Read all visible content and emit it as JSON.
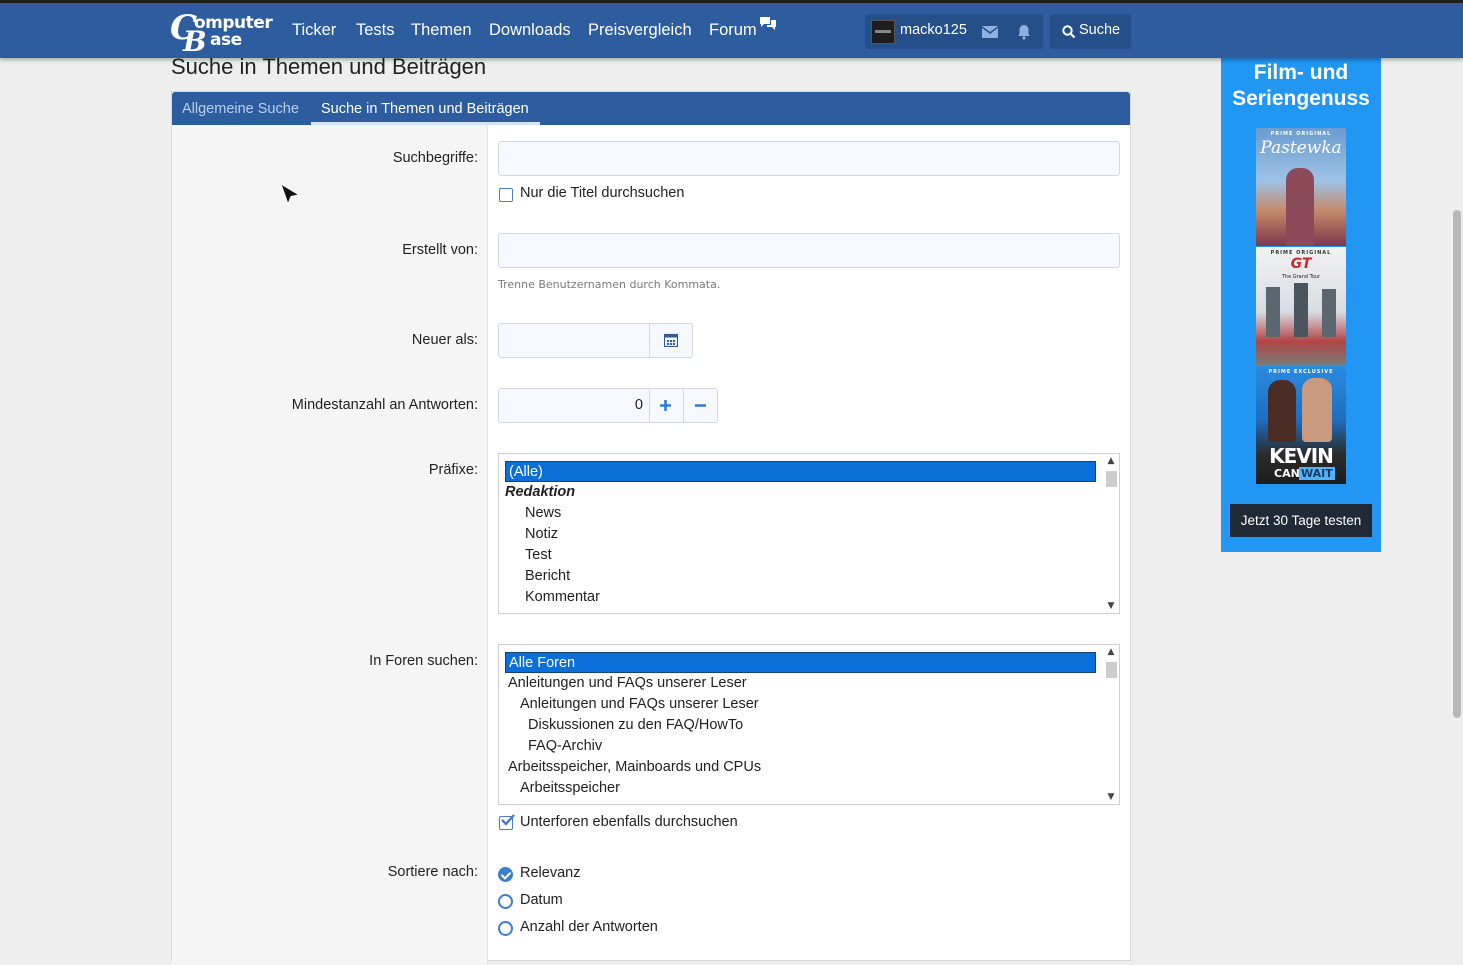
{
  "header": {
    "logo_top": "omputer",
    "logo_bottom": "ase",
    "logo_c": "C",
    "logo_b": "B",
    "nav": [
      "Ticker",
      "Tests",
      "Themen",
      "Downloads",
      "Preisvergleich",
      "Forum"
    ],
    "username": "macko125",
    "search_label": "Suche"
  },
  "page": {
    "title": "Suche in Themen und Beiträgen",
    "tabs": [
      "Allgemeine Suche",
      "Suche in Themen und Beiträgen"
    ]
  },
  "form": {
    "keywords_label": "Suchbegriffe:",
    "keywords_value": "",
    "titles_only_label": "Nur die Titel durchsuchen",
    "created_by_label": "Erstellt von:",
    "created_by_value": "",
    "created_by_hint": "Trenne Benutzernamen durch Kommata.",
    "newer_than_label": "Neuer als:",
    "min_replies_label": "Mindestanzahl an Antworten:",
    "min_replies_value": "0",
    "prefixes_label": "Präfixe:",
    "prefixes": [
      {
        "label": "(Alle)",
        "selected": true
      },
      {
        "label": "Redaktion",
        "group": true
      },
      {
        "label": "News"
      },
      {
        "label": "Notiz"
      },
      {
        "label": "Test"
      },
      {
        "label": "Bericht"
      },
      {
        "label": "Kommentar"
      }
    ],
    "forums_label": "In Foren suchen:",
    "forums": [
      {
        "label": "Alle Foren",
        "selected": true
      },
      {
        "label": "Anleitungen und FAQs unserer Leser"
      },
      {
        "label": "Anleitungen und FAQs unserer Leser"
      },
      {
        "label": "Diskussionen zu den FAQ/HowTo"
      },
      {
        "label": "FAQ-Archiv"
      },
      {
        "label": "Arbeitsspeicher, Mainboards und CPUs"
      },
      {
        "label": "Arbeitsspeicher"
      }
    ],
    "subforums_label": "Unterforen ebenfalls durchsuchen",
    "subforums_checked": true,
    "sort_label": "Sortiere nach:",
    "sort_options": [
      "Relevanz",
      "Datum",
      "Anzahl der Antworten"
    ],
    "sort_selected": "Relevanz"
  },
  "ad": {
    "title_line1": "Film- und",
    "title_line2": "Seriengenuss",
    "poster1_tag": "PRIME ORIGINAL",
    "poster1_title": "Pastewka",
    "poster2_tag": "PRIME ORIGINAL",
    "poster2_title": "GT",
    "poster2_subtitle": "The Grand Tour",
    "poster3_tag": "PRIME EXCLUSIVE",
    "poster3_title": "KEVIN",
    "poster3_subtitle_a": "CAN",
    "poster3_subtitle_b": "WAIT",
    "button": "Jetzt 30 Tage testen"
  },
  "colors": {
    "header_blue": "#2d5d9e",
    "selection_blue": "#0a6fd8",
    "ad_blue": "#2196f3",
    "accent": "#3d7ecb"
  }
}
